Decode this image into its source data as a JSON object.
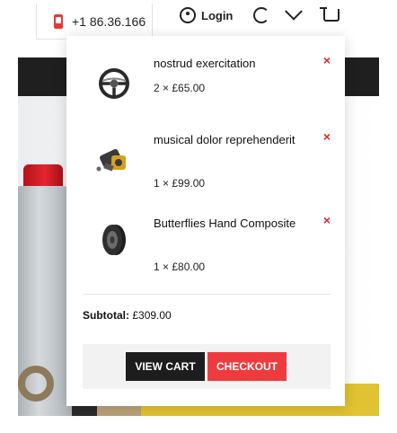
{
  "header": {
    "phone": "+1 86.36.166",
    "login_label": "Login"
  },
  "cart": {
    "items": [
      {
        "name": "nostrud exercitation",
        "price": "2 × £65.00",
        "thumb": "steering-wheel-icon",
        "remove": "×"
      },
      {
        "name": "musical dolor reprehenderit",
        "price": "1 × £99.00",
        "thumb": "brake-caliper-icon",
        "remove": "×"
      },
      {
        "name": "Butterflies Hand Composite",
        "price": "1 × £80.00",
        "thumb": "tire-icon",
        "remove": "×"
      }
    ],
    "subtotal_label": "Subtotal:",
    "subtotal_value": "£309.00",
    "view_cart_label": "VIEW CART",
    "checkout_label": "CHECKOUT"
  },
  "colors": {
    "accent": "#ee3b3f",
    "dark": "#1d1d1d",
    "remove": "#e2262f"
  }
}
